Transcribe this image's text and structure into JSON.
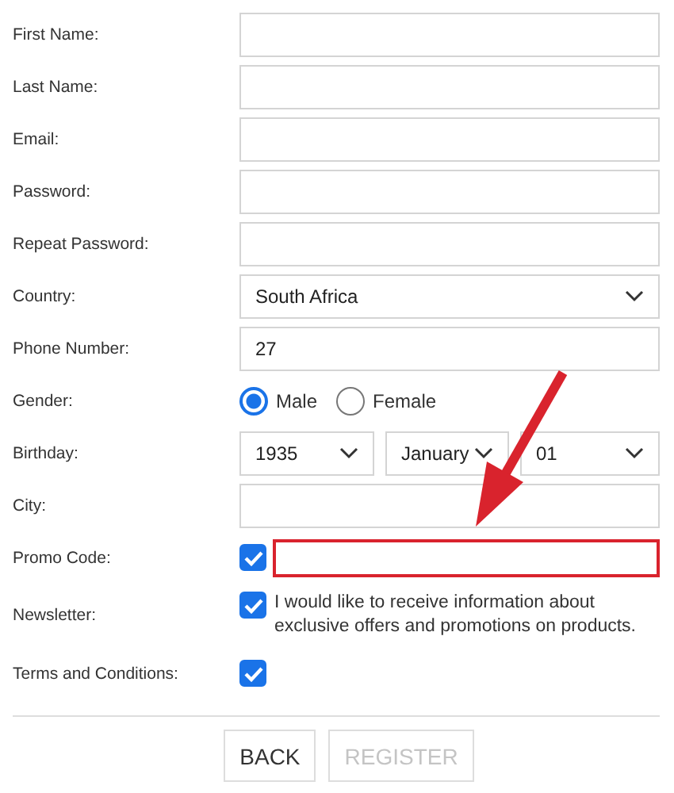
{
  "fields": [
    {
      "label": "First Name:",
      "kind": "text"
    },
    {
      "label": "Last Name:",
      "kind": "text"
    },
    {
      "label": "Email:",
      "kind": "text"
    },
    {
      "label": "Password:",
      "kind": "text"
    },
    {
      "label": "Repeat Password:",
      "kind": "text"
    },
    {
      "label": "Country:",
      "kind": "select",
      "value": "South Africa"
    },
    {
      "label": "Phone Number:",
      "kind": "text",
      "value": "27"
    },
    {
      "label": "Gender:",
      "kind": "radio",
      "options": [
        {
          "label": "Male",
          "selected": true
        },
        {
          "label": "Female",
          "selected": false
        }
      ]
    },
    {
      "label": "Birthday:",
      "kind": "date",
      "selects": [
        "1935",
        "January",
        "01"
      ]
    },
    {
      "label": "City:",
      "kind": "text"
    },
    {
      "label": "Promo Code:",
      "kind": "check-field",
      "checked": true,
      "highlighted": true
    },
    {
      "label": "Newsletter:",
      "kind": "check-text",
      "checked": true,
      "text": "I would like to receive information about exclusive offers and promotions on products."
    },
    {
      "label": "Terms and Conditions:",
      "kind": "check",
      "checked": true
    }
  ],
  "buttons": [
    {
      "label": "BACK",
      "disabled": false
    },
    {
      "label": "REGISTER",
      "disabled": true
    }
  ]
}
